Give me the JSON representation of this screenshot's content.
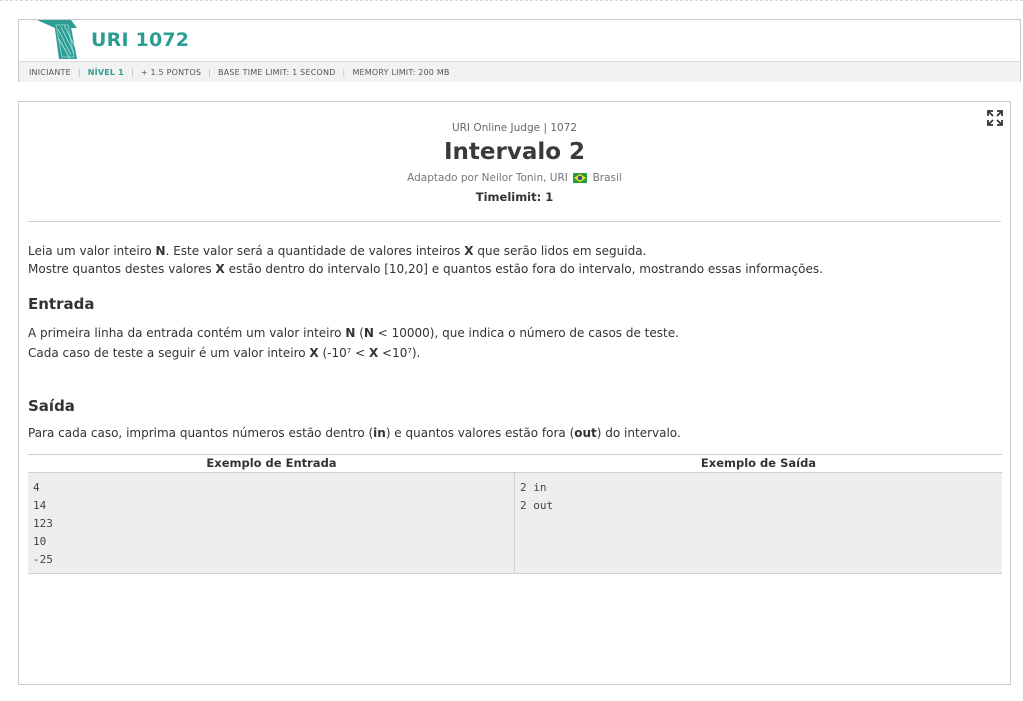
{
  "header": {
    "problem_code": "URI 1072",
    "meta": {
      "category": "INICIANTE",
      "level": "NÍVEL 1",
      "points": "+ 1.5 PONTOS",
      "time_limit": "BASE TIME LIMIT: 1 SECOND",
      "memory_limit": "MEMORY LIMIT: 200 MB"
    }
  },
  "problem": {
    "judge_line": "URI Online Judge | 1072",
    "title": "Intervalo 2",
    "author_prefix": "Adaptado por Neilor Tonin, URI",
    "author_country": "Brasil",
    "timelimit": "Timelimit: 1",
    "description": {
      "l1_a": "Leia um valor inteiro ",
      "l1_b": "N",
      "l1_c": ". Este valor será a quantidade de valores inteiros ",
      "l1_d": "X",
      "l1_e": " que serão lidos em seguida.",
      "l2_a": "Mostre quantos destes valores ",
      "l2_b": "X",
      "l2_c": " estão dentro do intervalo [10,20] e quantos estão fora do intervalo, mostrando essas informações."
    },
    "input_section": {
      "title": "Entrada",
      "l1_a": "A primeira linha da entrada contém um valor inteiro ",
      "l1_b": "N",
      "l1_c": " (",
      "l1_d": "N",
      "l1_e": " < 10000), que indica o número de casos de teste.",
      "l2_a": "Cada caso de teste a seguir é um valor inteiro ",
      "l2_b": "X",
      "l2_c": " (-10",
      "l2_sup1": "7",
      "l2_d": " < ",
      "l2_e": "X",
      "l2_f": " <10",
      "l2_sup2": "7",
      "l2_g": ")."
    },
    "output_section": {
      "title": "Saída",
      "l1_a": "Para cada caso, imprima quantos números estão dentro (",
      "l1_b": "in",
      "l1_c": ") e quantos valores estão fora (",
      "l1_d": "out",
      "l1_e": ") do intervalo."
    },
    "examples": {
      "input_header": "Exemplo de Entrada",
      "output_header": "Exemplo de Saída",
      "input_text": "4\n14\n123\n10\n-25",
      "output_text": "2 in\n2 out"
    }
  },
  "icons": {
    "expand": "expand-icon",
    "flag": "brazil-flag-icon",
    "logo": "uri-logo-icon"
  },
  "colors": {
    "accent": "#2c9d94"
  }
}
